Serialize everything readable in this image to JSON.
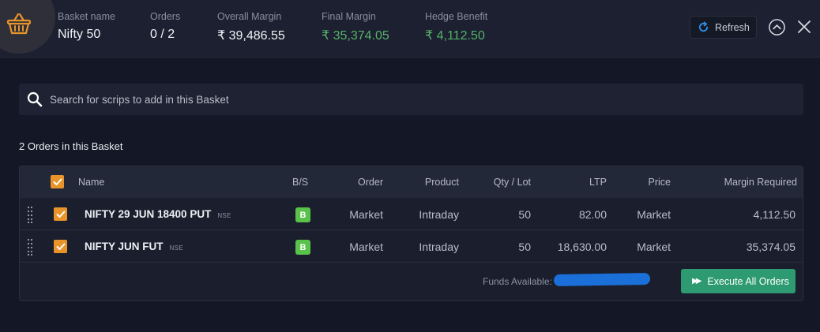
{
  "header": {
    "basket_name_label": "Basket name",
    "basket_name": "Nifty 50",
    "orders_label": "Orders",
    "orders": "0 / 2",
    "overall_margin_label": "Overall Margin",
    "overall_margin": "₹ 39,486.55",
    "final_margin_label": "Final Margin",
    "final_margin": "₹ 35,374.05",
    "hedge_benefit_label": "Hedge Benefit",
    "hedge_benefit": "₹ 4,112.50",
    "refresh_label": "Refresh",
    "icons": {
      "logo": "basket-icon",
      "refresh": "refresh-icon",
      "collapse": "chevron-up-icon",
      "close": "close-icon"
    }
  },
  "search": {
    "placeholder": "Search for scrips to add in this Basket",
    "icon": "search-icon"
  },
  "orders_title": "2 Orders in this Basket",
  "table": {
    "columns": [
      "Name",
      "B/S",
      "Order",
      "Product",
      "Qty / Lot",
      "LTP",
      "Price",
      "Margin Required"
    ],
    "rows": [
      {
        "name": "NIFTY 29 JUN 18400 PUT",
        "exchange": "NSE",
        "side": "B",
        "order": "Market",
        "product": "Intraday",
        "qty": "50",
        "ltp": "82.00",
        "price": "Market",
        "margin": "4,112.50",
        "checked": true
      },
      {
        "name": "NIFTY JUN FUT",
        "exchange": "NSE",
        "side": "B",
        "order": "Market",
        "product": "Intraday",
        "qty": "50",
        "ltp": "18,630.00",
        "price": "Market",
        "margin": "35,374.05",
        "checked": true
      }
    ]
  },
  "footer": {
    "funds_label": "Funds Available:",
    "execute_label": "Execute All Orders"
  },
  "colors": {
    "accent_green": "#57b26a",
    "checkbox": "#e8942a",
    "buy_badge": "#58c24a",
    "execute_button": "#2d9a72"
  }
}
